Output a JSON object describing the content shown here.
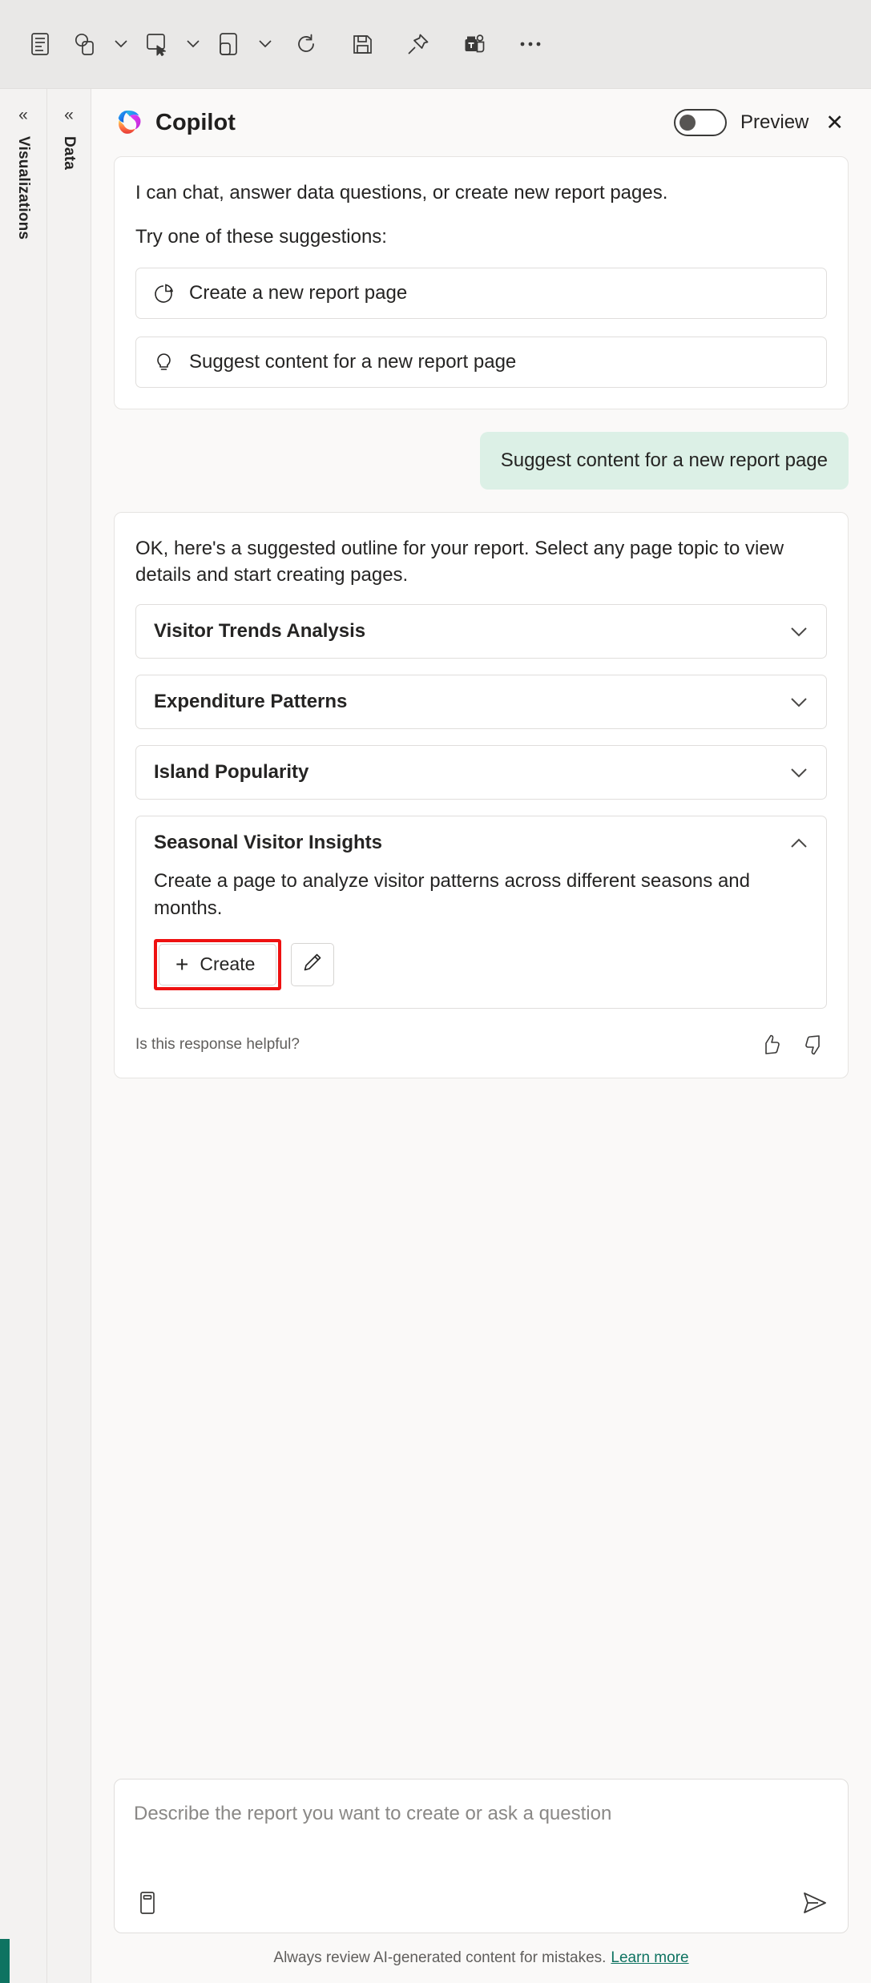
{
  "toolbar": {
    "items": [
      {
        "name": "page-view-icon",
        "icon": "document"
      },
      {
        "name": "new-visual-icon",
        "icon": "shapes",
        "caret": true
      },
      {
        "name": "new-page-icon",
        "icon": "page-cursor",
        "caret": true
      },
      {
        "name": "new-visual-copy-icon",
        "icon": "copy",
        "caret": true
      },
      {
        "name": "refresh-icon",
        "icon": "refresh"
      },
      {
        "name": "save-icon",
        "icon": "save"
      },
      {
        "name": "pin-icon",
        "icon": "pin"
      },
      {
        "name": "teams-icon",
        "icon": "teams"
      },
      {
        "name": "more-options-icon",
        "icon": "ellipsis"
      }
    ]
  },
  "rails": {
    "visualizations": {
      "label": "Visualizations",
      "collapse": "«"
    },
    "data": {
      "label": "Data",
      "collapse": "«"
    }
  },
  "copilot": {
    "title": "Copilot",
    "preview_label": "Preview",
    "toggle_state": "off",
    "close_label": "✕",
    "intro": {
      "line1": "I can chat, answer data questions, or create new report pages.",
      "line2": "Try one of these suggestions:",
      "suggestions": [
        {
          "label": "Create a new report page",
          "icon": "pie-chart-icon"
        },
        {
          "label": "Suggest content for a new report page",
          "icon": "lightbulb-icon"
        }
      ]
    },
    "user_message": "Suggest content for a new report page",
    "answer": {
      "text": "OK, here's a suggested outline for your report. Select any page topic to view details and start creating pages.",
      "topics": [
        {
          "title": "Visitor Trends Analysis",
          "expanded": false,
          "description": ""
        },
        {
          "title": "Expenditure Patterns",
          "expanded": false,
          "description": ""
        },
        {
          "title": "Island Popularity",
          "expanded": false,
          "description": ""
        },
        {
          "title": "Seasonal Visitor Insights",
          "expanded": true,
          "description": "Create a page to analyze visitor patterns across different seasons and months.",
          "create_label": "Create",
          "create_plus": "+",
          "edit_icon": "pencil-icon",
          "highlighted": true
        }
      ],
      "feedback_text": "Is this response helpful?",
      "thumbs_up_icon": "thumbs-up-icon",
      "thumbs_down_icon": "thumbs-down-icon"
    },
    "composer": {
      "placeholder": "Describe the report you want to create or ask a question",
      "value": "",
      "prompt_guide_icon": "book-icon",
      "send_icon": "send-icon"
    },
    "disclaimer": {
      "text": "Always review AI-generated content for mistakes.",
      "link": "Learn more"
    }
  },
  "colors": {
    "accent_green": "#0e7361",
    "user_bubble": "#dcf0e6",
    "highlight_red": "#ee1111",
    "toolbar_bg": "#e9e8e7",
    "panel_bg": "#faf9f8"
  }
}
